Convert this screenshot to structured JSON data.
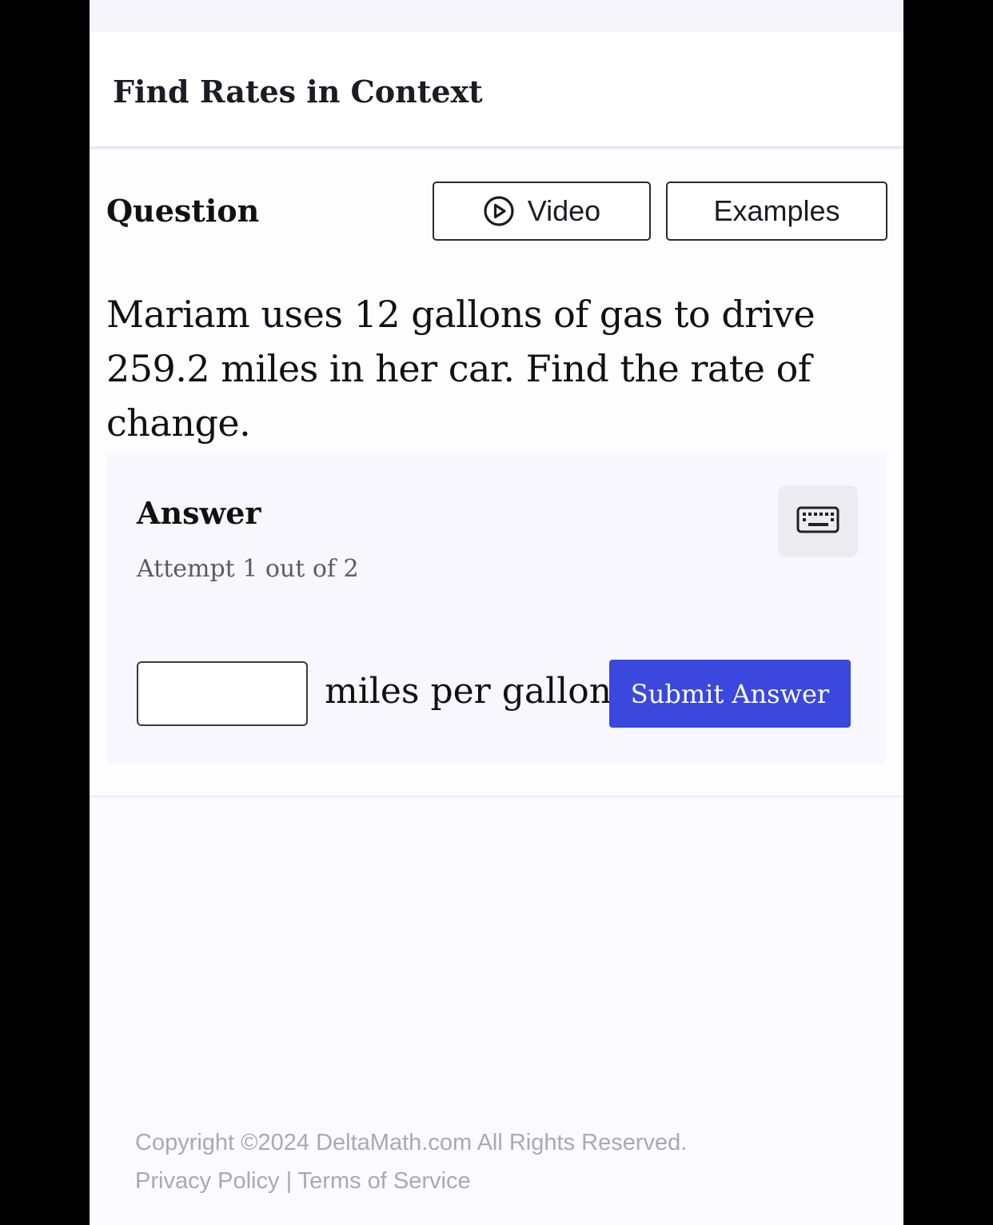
{
  "header": {
    "title": "Find Rates in Context"
  },
  "question": {
    "label": "Question",
    "video_label": "Video",
    "examples_label": "Examples",
    "text": "Mariam uses 12 gallons of gas to drive 259.2 miles in her car. Find the rate of change."
  },
  "answer": {
    "label": "Answer",
    "attempt": "Attempt 1 out of 2",
    "input_value": "",
    "unit": "miles per gallon",
    "submit_label": "Submit Answer"
  },
  "footer": {
    "copyright": "Copyright ©2024 DeltaMath.com All Rights Reserved.",
    "privacy": "Privacy Policy",
    "separator": "|",
    "terms": "Terms of Service"
  },
  "colors": {
    "accent": "#3a48de",
    "background": "#fbfaff",
    "muted_text": "#a9a9b4"
  },
  "icons": {
    "video": "play-circle-icon",
    "keyboard": "keyboard-icon"
  }
}
